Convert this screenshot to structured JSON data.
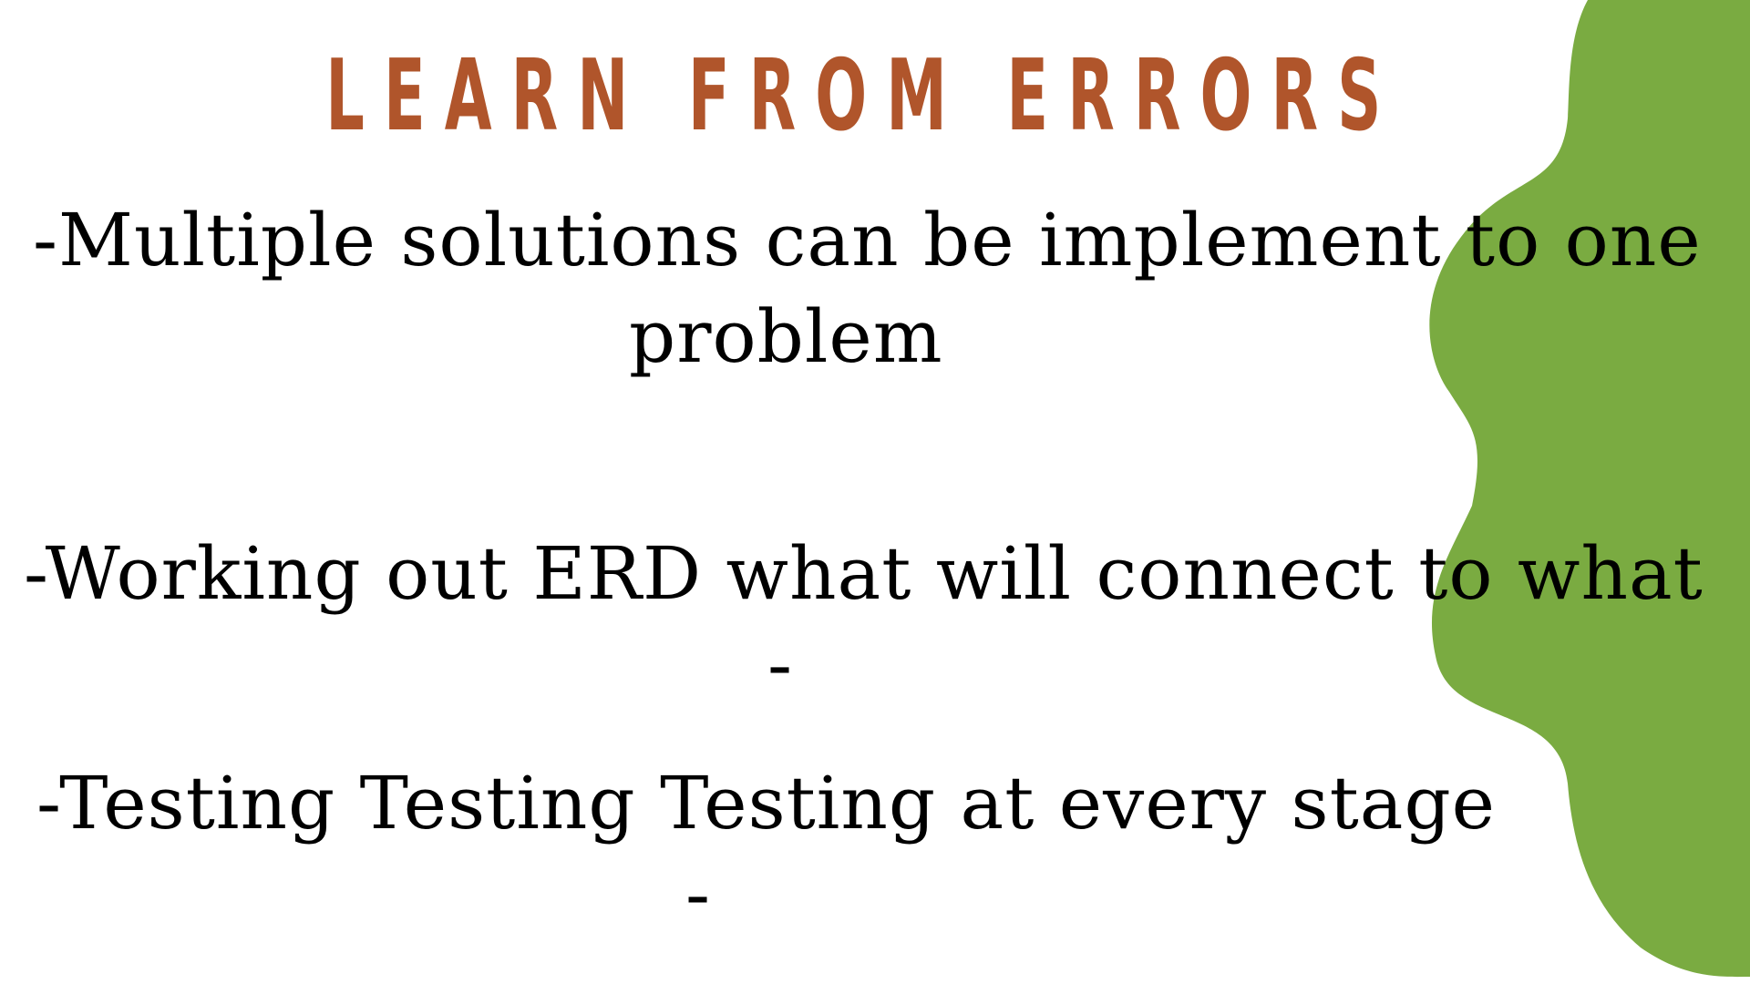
{
  "slide": {
    "title": "LEARN FROM ERRORS",
    "bullets": [
      "-Multiple solutions can be implement to one",
      "problem",
      "-Working out ERD what will connect to what",
      "-",
      "-Testing Testing Testing at every stage",
      "-"
    ]
  },
  "colors": {
    "title": "#b0552b",
    "accent_shape": "#7aab41",
    "background": "#ffffff",
    "text": "#000000"
  }
}
